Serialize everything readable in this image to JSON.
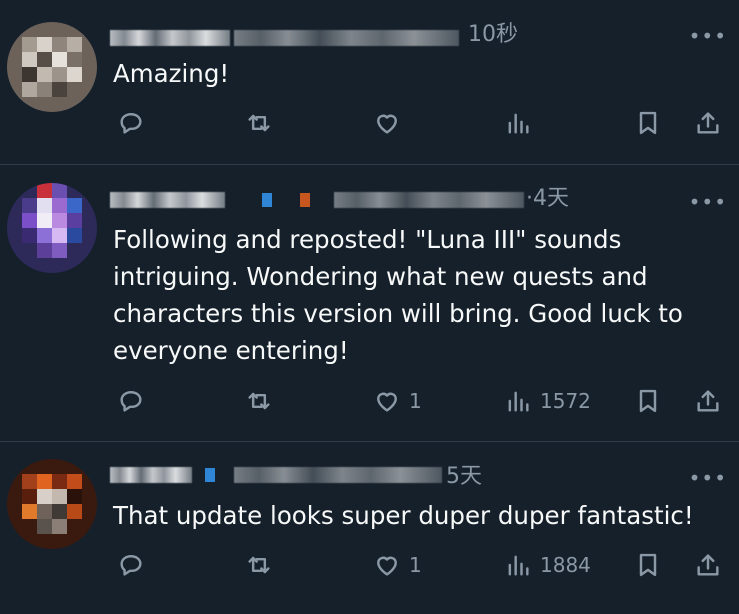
{
  "replies": [
    {
      "time": "10秒",
      "text": "Amazing!",
      "likes": "",
      "views": "",
      "more_label": "•••"
    },
    {
      "time": "·4天",
      "text": "Following and reposted! \"Luna III\" sounds intriguing. Wondering what new quests and characters this version will bring. Good luck to everyone entering!",
      "likes": "1",
      "views": "1572",
      "more_label": "•••"
    },
    {
      "time": "5天",
      "text": "That update looks super duper duper fantastic!",
      "likes": "1",
      "views": "1884",
      "more_label": "•••"
    }
  ],
  "icons": [
    "reply-icon",
    "repost-icon",
    "like-icon",
    "views-icon",
    "bookmark-icon",
    "share-icon",
    "more-icon"
  ],
  "colors": {
    "background": "#15202b",
    "text": "#f7f9f9",
    "muted": "#8b98a5",
    "divider": "#2f3b47"
  }
}
